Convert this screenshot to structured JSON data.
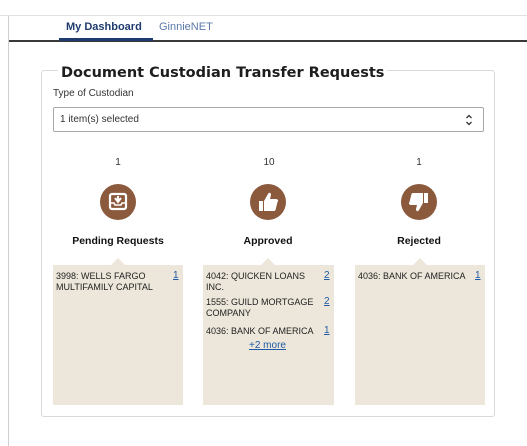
{
  "nav": {
    "tabs": [
      {
        "label": "My Dashboard",
        "active": true
      },
      {
        "label": "GinnieNET",
        "active": false
      }
    ]
  },
  "card": {
    "title": "Document Custodian Transfer Requests",
    "type_label": "Type of Custodian",
    "select_value": "1 item(s) selected"
  },
  "colors": {
    "icon_bg": "#8b5a3c",
    "panel_bg": "#ece7da",
    "link": "#1f5aa6",
    "nav_active": "#1f3b6e"
  },
  "columns": [
    {
      "count": "1",
      "label": "Pending Requests",
      "icon": "inbox-icon",
      "items": [
        {
          "name": "3998: WELLS FARGO MULTIFAMILY CAPITAL",
          "count": "1"
        }
      ]
    },
    {
      "count": "10",
      "label": "Approved",
      "icon": "thumbs-up-icon",
      "items": [
        {
          "name": "4042: QUICKEN LOANS INC.",
          "count": "2"
        },
        {
          "name": "1555: GUILD MORTGAGE COMPANY",
          "count": "2"
        },
        {
          "name": "4036: BANK OF AMERICA",
          "count": "1"
        }
      ],
      "more": "+2 more"
    },
    {
      "count": "1",
      "label": "Rejected",
      "icon": "thumbs-down-icon",
      "items": [
        {
          "name": "4036: BANK OF AMERICA",
          "count": "1"
        }
      ]
    }
  ]
}
